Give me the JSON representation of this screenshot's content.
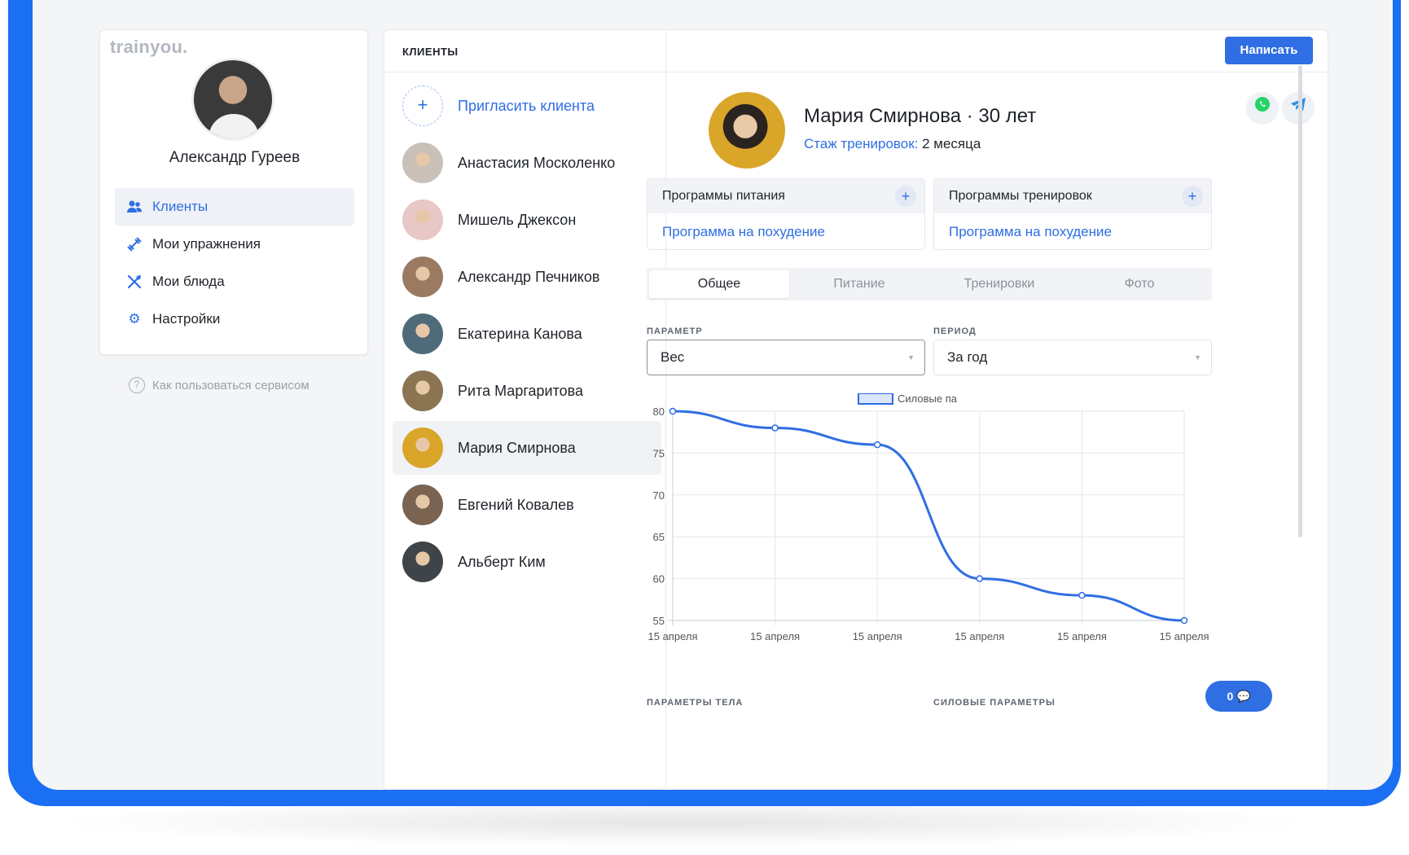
{
  "app": {
    "logo": "trainyou."
  },
  "trainer": {
    "name": "Александр Гуреев"
  },
  "nav": [
    {
      "label": "Клиенты",
      "icon": "users-icon",
      "active": true
    },
    {
      "label": "Мои упражнения",
      "icon": "dumbbell-icon",
      "active": false
    },
    {
      "label": "Мои блюда",
      "icon": "cutlery-icon",
      "active": false
    },
    {
      "label": "Настройки",
      "icon": "gear-icon",
      "active": false
    }
  ],
  "help": {
    "label": "Как пользоваться сервисом",
    "icon": "question-icon"
  },
  "header": {
    "title": "КЛИЕНТЫ",
    "write_label": "Написать"
  },
  "clients": {
    "invite_label": "Пригласить клиента",
    "items": [
      {
        "name": "Анастасия Москоленко",
        "color": "#c9c1b8"
      },
      {
        "name": "Мишель Джексон",
        "color": "#e8c7c7"
      },
      {
        "name": "Александр Печников",
        "color": "#9c7a62"
      },
      {
        "name": "Екатерина Канова",
        "color": "#4f6b7a"
      },
      {
        "name": "Рита Маргаритова",
        "color": "#8a7452"
      },
      {
        "name": "Мария Смирнова",
        "color": "#d9a62a",
        "active": true
      },
      {
        "name": "Евгений Ковалев",
        "color": "#7a6351"
      },
      {
        "name": "Альберт Ким",
        "color": "#3f4448"
      }
    ]
  },
  "profile": {
    "name": "Мария Смирнова · 30 лет",
    "exp_key": "Стаж тренировок:",
    "exp_value": " 2 месяца",
    "messengers": [
      "whatsapp-icon",
      "telegram-icon"
    ]
  },
  "programs": {
    "nutrition": {
      "title": "Программы питания",
      "link": "Программа на похудение"
    },
    "training": {
      "title": "Программы тренировок",
      "link": "Программа на похудение"
    }
  },
  "tabs": [
    "Общее",
    "Питание",
    "Тренировки",
    "Фото"
  ],
  "filters": {
    "param_label": "ПАРАМЕТР",
    "param_value": "Вес",
    "period_label": "ПЕРИОД",
    "period_value": "За год"
  },
  "bottom_labels": {
    "left": "ПАРАМЕТРЫ ТЕЛА",
    "right": "СИЛОВЫЕ ПАРАМЕТРЫ"
  },
  "chat": {
    "count": "0"
  },
  "colors": {
    "accent": "#2f6ee3",
    "frame": "#1a6ff2"
  },
  "chart_data": {
    "type": "line",
    "categories": [
      "15 апреля",
      "15 апреля",
      "15 апреля",
      "15 апреля",
      "15 апреля",
      "15 апреля"
    ],
    "series": [
      {
        "name": "Силовые па",
        "values": [
          80,
          78,
          76,
          60,
          58,
          55
        ]
      }
    ],
    "ylim": [
      55,
      80
    ],
    "yticks": [
      80,
      75,
      70,
      65,
      60,
      55
    ],
    "grid": true,
    "legend": "top"
  }
}
